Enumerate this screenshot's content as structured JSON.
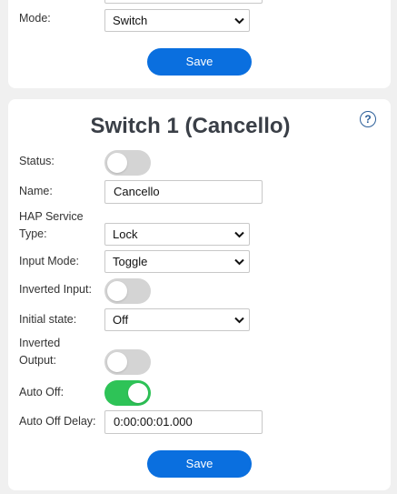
{
  "top_section": {
    "mode_label": "Mode:",
    "mode_value": "Switch",
    "save_label": "Save"
  },
  "switch_section": {
    "title": "Switch 1 (Cancello)",
    "help_icon": "?",
    "status_label": "Status:",
    "status_on": false,
    "name_label": "Name:",
    "name_value": "Cancello",
    "hap_type_label_line1": "HAP Service",
    "hap_type_label_line2": "Type:",
    "hap_type_value": "Lock",
    "input_mode_label": "Input Mode:",
    "input_mode_value": "Toggle",
    "inverted_input_label": "Inverted Input:",
    "inverted_input_on": false,
    "initial_state_label": "Initial state:",
    "initial_state_value": "Off",
    "inverted_output_label_line1": "Inverted",
    "inverted_output_label_line2": "Output:",
    "inverted_output_on": false,
    "auto_off_label": "Auto Off:",
    "auto_off_on": true,
    "auto_off_delay_label": "Auto Off Delay:",
    "auto_off_delay_value": "0:00:00:01.000",
    "save_label": "Save"
  },
  "colors": {
    "accent": "#0a6fdf",
    "toggle_on": "#2ec357",
    "toggle_off": "#d4d4d4"
  },
  "icons": [
    "chevron-down-icon",
    "help-icon"
  ]
}
